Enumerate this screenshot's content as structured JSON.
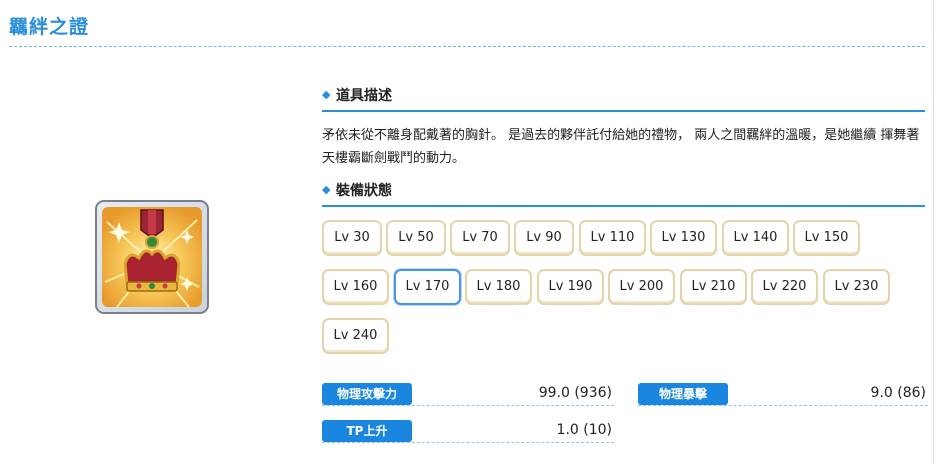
{
  "page": {
    "title": "羈絆之證"
  },
  "item": {
    "icon": "medal-crown-icon"
  },
  "sections": {
    "description_heading": "道具描述",
    "description_text": "矛依未從不離身配戴著的胸針。 是過去的夥伴託付給她的禮物， 兩人之間羈絆的溫暖，是她繼續 揮舞著天樓霸斷劍戰鬥的動力。",
    "equip_heading": "裝備狀態"
  },
  "levels": [
    "Lv 30",
    "Lv 50",
    "Lv 70",
    "Lv 90",
    "Lv 110",
    "Lv 130",
    "Lv 140",
    "Lv 150",
    "Lv 160",
    "Lv 170",
    "Lv 180",
    "Lv 190",
    "Lv 200",
    "Lv 210",
    "Lv 220",
    "Lv 230",
    "Lv 240"
  ],
  "selected_level": "Lv 170",
  "stats": [
    {
      "label": "物理攻擊力",
      "value": "99.0 (936)"
    },
    {
      "label": "物理暴擊",
      "value": "9.0 (86)"
    },
    {
      "label": "TP上升",
      "value": "1.0 (10)"
    }
  ],
  "colors": {
    "accent": "#2a8fd8",
    "badge": "#1a86e0",
    "button_border": "#e3d4a9",
    "selected_border": "#4a97e0"
  }
}
